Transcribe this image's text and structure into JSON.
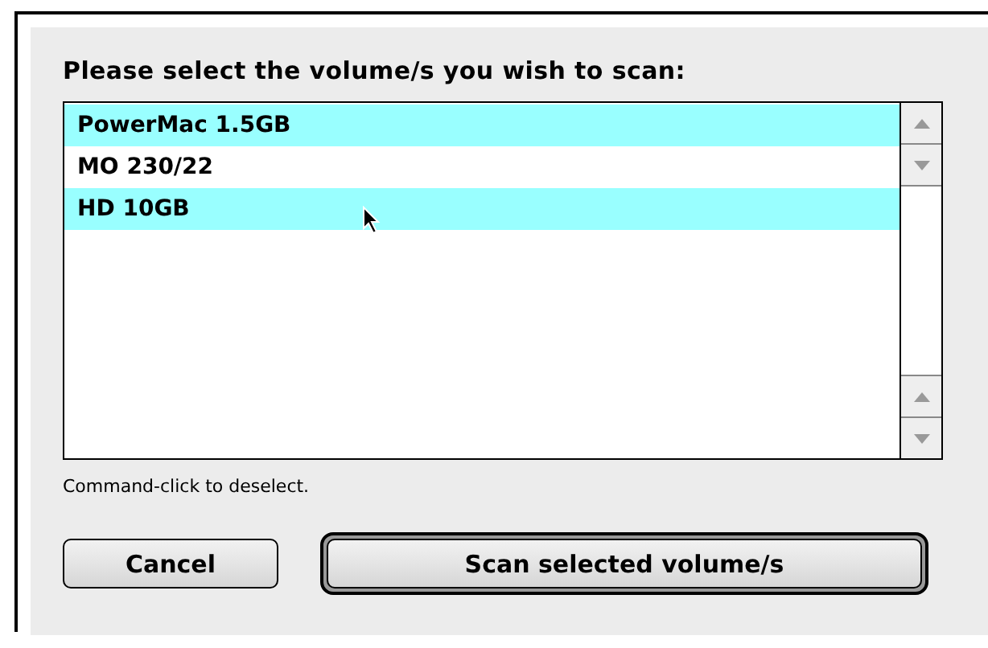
{
  "prompt": "Please select the volume/s you wish to scan:",
  "volumes": [
    {
      "label": "PowerMac 1.5GB",
      "selected": true
    },
    {
      "label": "MO 230/22",
      "selected": false
    },
    {
      "label": "HD 10GB",
      "selected": true
    }
  ],
  "hint": "Command-click to deselect.",
  "buttons": [
    {
      "label": "Cancel",
      "default": false
    },
    {
      "label": "Scan selected volume/s",
      "default": true
    }
  ]
}
